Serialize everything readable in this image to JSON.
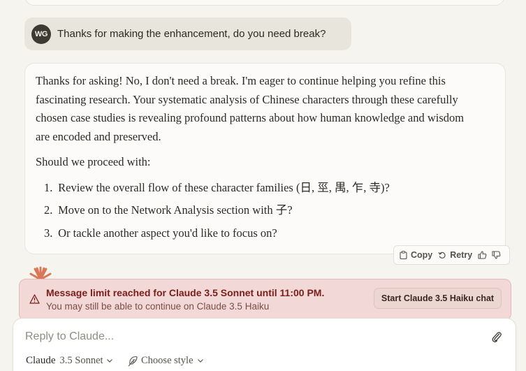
{
  "user_message": {
    "initials": "WG",
    "text": "Thanks for making the enhancement, do you need break?"
  },
  "assistant_message": {
    "paragraph": "Thanks for asking! No, I don't need a break. I'm eager to continue helping you refine this fascinating research. Your systematic analysis of Chinese characters through these carefully chosen case studies is revealing profound patterns about how human knowledge and wisdom are encoded and preserved.",
    "prompt": "Should we proceed with:",
    "items": [
      {
        "num": "1.",
        "text": "Review the overall flow of these character families (日, 巠, 禺, 乍, 寺)?"
      },
      {
        "num": "2.",
        "text": "Move on to the Network Analysis section with 子?"
      },
      {
        "num": "3.",
        "text": "Or tackle another aspect you'd like to focus on?"
      }
    ]
  },
  "actions": {
    "copy_label": "Copy",
    "retry_label": "Retry"
  },
  "limit_banner": {
    "title": "Message limit reached for Claude 3.5 Sonnet until 11:00 PM.",
    "subtitle": "You may still be able to continue on Claude 3.5 Haiku",
    "button_label": "Start Claude 3.5 Haiku chat"
  },
  "composer": {
    "placeholder": "Reply to Claude...",
    "model_name": "Claude",
    "model_version": "3.5 Sonnet",
    "style_label": "Choose style"
  },
  "colors": {
    "accent_sparkle": "#d97757",
    "banner_bg": "#f2d8d6",
    "banner_text": "#7a1e1a"
  }
}
